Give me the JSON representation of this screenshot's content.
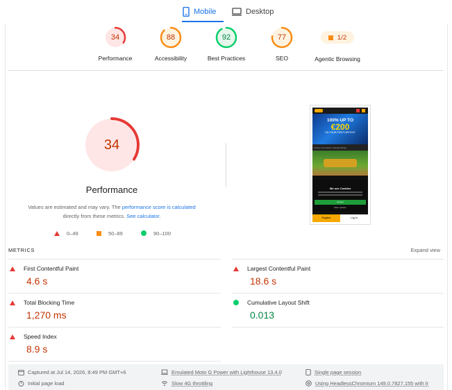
{
  "tabs": [
    {
      "label": "Mobile",
      "active": true
    },
    {
      "label": "Desktop",
      "active": false
    }
  ],
  "gauges": [
    {
      "score": "34",
      "label": "Performance",
      "status": "fail",
      "value": 34
    },
    {
      "score": "88",
      "label": "Accessibility",
      "status": "average",
      "value": 88
    },
    {
      "score": "92",
      "label": "Best Practices",
      "status": "pass",
      "value": 92
    },
    {
      "score": "77",
      "label": "SEO",
      "status": "average",
      "value": 77
    }
  ],
  "agentic": {
    "score": "1/2",
    "label": "Agentic Browsing"
  },
  "performance": {
    "score": "34",
    "value": 34,
    "title": "Performance",
    "note_pre": "Values are estimated and may vary. The ",
    "note_link1": "performance score is calculated",
    "note_mid": " directly from these metrics. ",
    "note_link2": "See calculator",
    "note_post": "."
  },
  "legend": [
    {
      "range": "0–49",
      "shape": "triangle",
      "color": "#e53935"
    },
    {
      "range": "50–89",
      "shape": "square",
      "color": "#fa8c16"
    },
    {
      "range": "90–100",
      "shape": "circle",
      "color": "#0cce6b"
    }
  ],
  "phone": {
    "headline": "100% UP TO",
    "amount": "€200",
    "sub": "ON YOUR FIRST DEPOSIT",
    "nav": "Casino   Live Casino   Jackpots   Bingo",
    "cookie_title": "We use Cookies",
    "accept": "Accept",
    "more_info": "More options",
    "register": "Register",
    "login": "Log In"
  },
  "metrics": {
    "title": "METRICS",
    "expand": "Expand view",
    "items": [
      {
        "label": "First Contentful Paint",
        "value": "4.6 s",
        "status": "fail"
      },
      {
        "label": "Largest Contentful Paint",
        "value": "18.6 s",
        "status": "fail"
      },
      {
        "label": "Total Blocking Time",
        "value": "1,270 ms",
        "status": "fail"
      },
      {
        "label": "Cumulative Layout Shift",
        "value": "0.013",
        "status": "pass"
      },
      {
        "label": "Speed Index",
        "value": "8.9 s",
        "status": "fail"
      }
    ]
  },
  "info": {
    "captured": "Captured at Jul 14, 2026, 8:49 PM GMT+6",
    "initial": "Initial page load",
    "device": "Emulated Moto G Power with Lighthouse 13.4.0",
    "throttling": "Slow 4G throttling",
    "session": "Single page session",
    "browser": "Using HeadlessChromium 149.0.7827.155 with lr"
  },
  "colors": {
    "fail": "#e53935",
    "average": "#fa8c16",
    "pass": "#0cce6b",
    "accent": "#1a73e8"
  }
}
